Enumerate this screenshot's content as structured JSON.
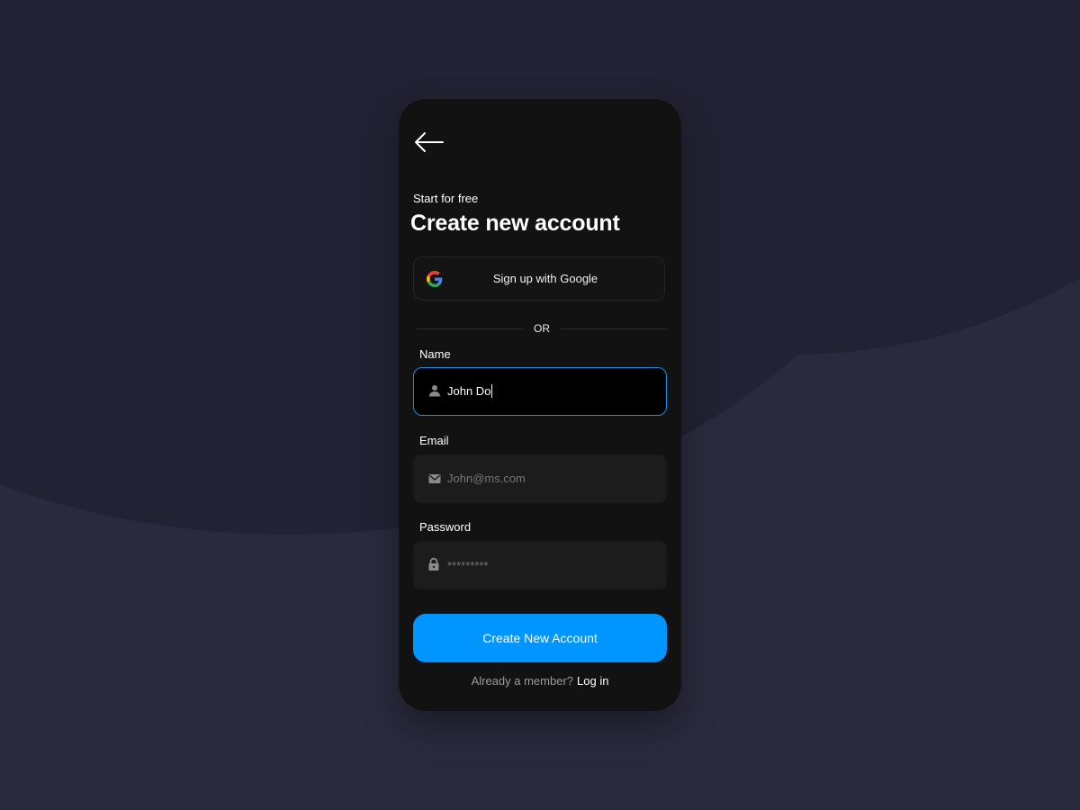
{
  "screen": {
    "back_icon": "arrow-left-icon",
    "subtitle": "Start for free",
    "title": "Create new account"
  },
  "google_signup": {
    "label": "Sign up with Google",
    "icon": "google-icon"
  },
  "divider": {
    "text": "OR"
  },
  "form": {
    "name": {
      "label": "Name",
      "value": "John Do",
      "icon": "user-icon",
      "focused": true
    },
    "email": {
      "label": "Email",
      "placeholder": "John@ms.com",
      "icon": "mail-icon"
    },
    "password": {
      "label": "Password",
      "placeholder": "*********",
      "icon": "lock-icon"
    }
  },
  "submit": {
    "label": "Create New Account"
  },
  "footer": {
    "prompt": "Already a member?",
    "link": "Log in"
  },
  "colors": {
    "background": "#2a2a3e",
    "card": "#121212",
    "accent": "#0095ff",
    "focus_border": "#1a8fe6"
  }
}
